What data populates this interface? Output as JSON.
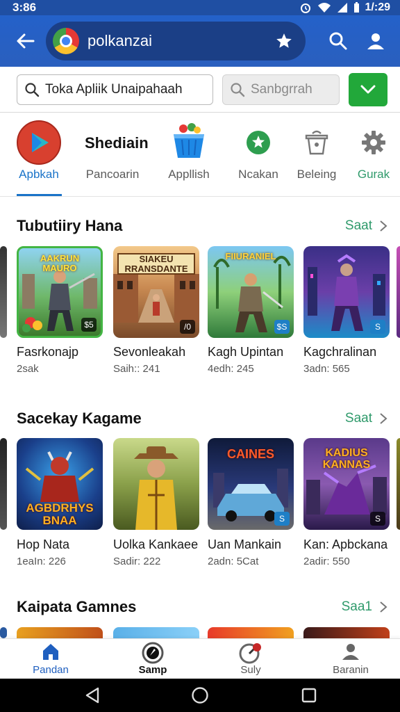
{
  "status_bar": {
    "time": "3:86",
    "clock_right": "1/:29"
  },
  "app_bar": {
    "url": "polkanzai"
  },
  "search": {
    "main_value": "Toka Apliik Unaipahaah",
    "secondary_value": "Sanbgrrah"
  },
  "categories": {
    "items": [
      {
        "label": "Apbkah",
        "icon": "play-store-logo-icon"
      },
      {
        "label": "Pancoarin",
        "icon": "none"
      },
      {
        "label": "Appllish",
        "icon": "basket-icon"
      },
      {
        "label": "Ncakan",
        "icon": "star-badge-icon"
      },
      {
        "label": "Beleing",
        "icon": "bucket-icon"
      },
      {
        "label": "Gurak",
        "icon": "gear-icon"
      }
    ],
    "header_text": "Shediain"
  },
  "sections": [
    {
      "title": "Tubutiiry Hana",
      "see_all": "Saat",
      "cards": [
        {
          "name": "Fasrkonajp",
          "meta": "2sak",
          "banner": "AAKRUN MAURO",
          "badge": "$5"
        },
        {
          "name": "Sevonleakah",
          "meta": "Saih:: 241",
          "banner": "SIAKEU RRANSDANTE",
          "badge": "/0"
        },
        {
          "name": "Kagh Upintan",
          "meta": "4edh: 245",
          "banner": "FIIURANIEL",
          "badge": "$S"
        },
        {
          "name": "Kagchralinan",
          "meta": "3adn: 565",
          "banner": "",
          "badge": "S"
        }
      ]
    },
    {
      "title": "Sacekay Kagame",
      "see_all": "Saat",
      "cards": [
        {
          "name": "Hop Nata",
          "meta": "1eaIn: 226",
          "banner": "AGBDRHYS BNAA",
          "badge": ""
        },
        {
          "name": "Uolka Kankaee",
          "meta": "Sadir: 222",
          "banner": "",
          "badge": ""
        },
        {
          "name": "Uan Mankain",
          "meta": "2adn: 5Cat",
          "banner": "CAINES",
          "badge": "S"
        },
        {
          "name": "Kan: Apbckana",
          "meta": "2adir: 550",
          "banner": "KADIUS KANNAS",
          "badge": "S"
        }
      ]
    },
    {
      "title": "Kaipata Gamnes",
      "see_all": "Saa1",
      "cards": []
    }
  ],
  "bottom_nav": [
    {
      "label": "Pandan",
      "icon": "home-icon"
    },
    {
      "label": "Samp",
      "icon": "compass-icon"
    },
    {
      "label": "Suly",
      "icon": "gauge-icon"
    },
    {
      "label": "Baranin",
      "icon": "person-icon"
    }
  ],
  "colors": {
    "app_bar": "#2461c9",
    "accent_blue": "#1a73c8",
    "see_all_green": "#2f9a6b",
    "confirm_green": "#22a83a"
  }
}
